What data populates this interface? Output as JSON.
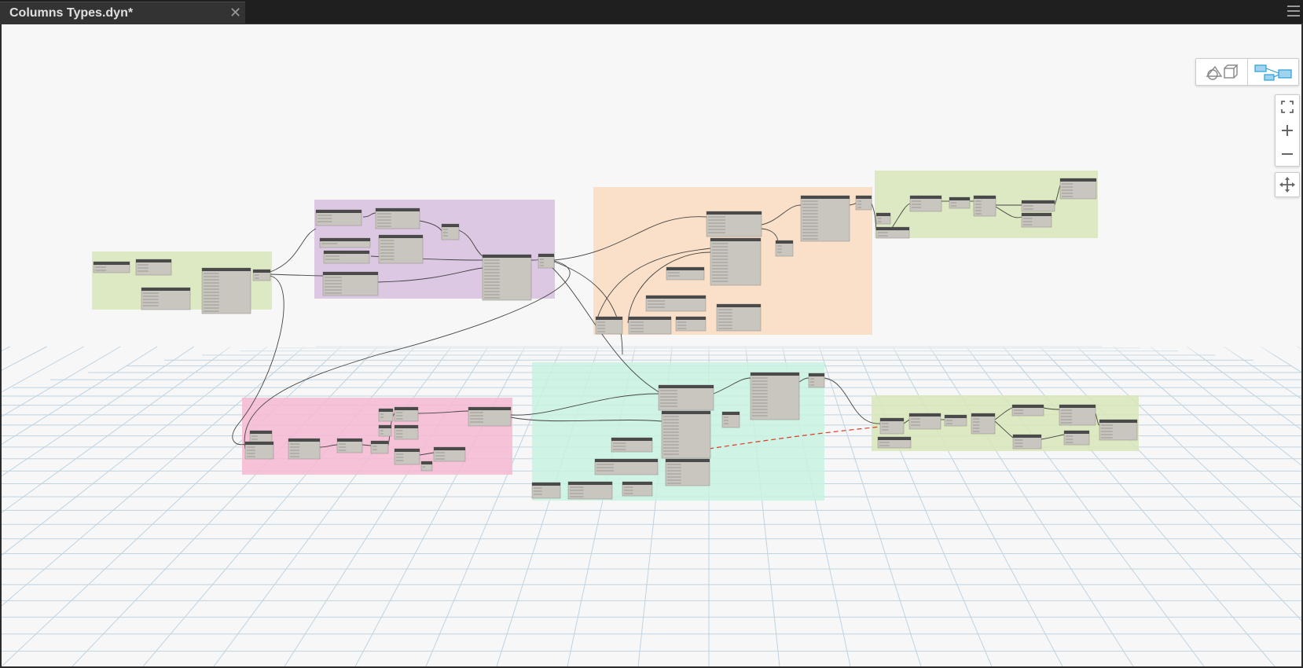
{
  "tab": {
    "title": "Columns Types.dyn*",
    "close_glyph": "✕"
  },
  "view_toggle": {
    "geometry_view": "geometry-view-icon",
    "graph_view": "graph-view-icon",
    "active": "graph"
  },
  "nav_controls": {
    "fit": "zoom-to-fit-icon",
    "zoom_in": "zoom-in-icon",
    "zoom_out": "zoom-out-icon",
    "pan": "pan-icon"
  },
  "colors": {
    "canvas": "#f7f7f7",
    "group_green": "#d8e6b8",
    "group_purple": "#d8bfe0",
    "group_orange": "#fbdcc1",
    "group_pink": "#f6b8d2",
    "group_teal": "#c8f2e0",
    "node_header": "#4a4a4a",
    "node_body": "#c9c5bf",
    "wire": "#444444",
    "accent": "#2a9fd8"
  }
}
